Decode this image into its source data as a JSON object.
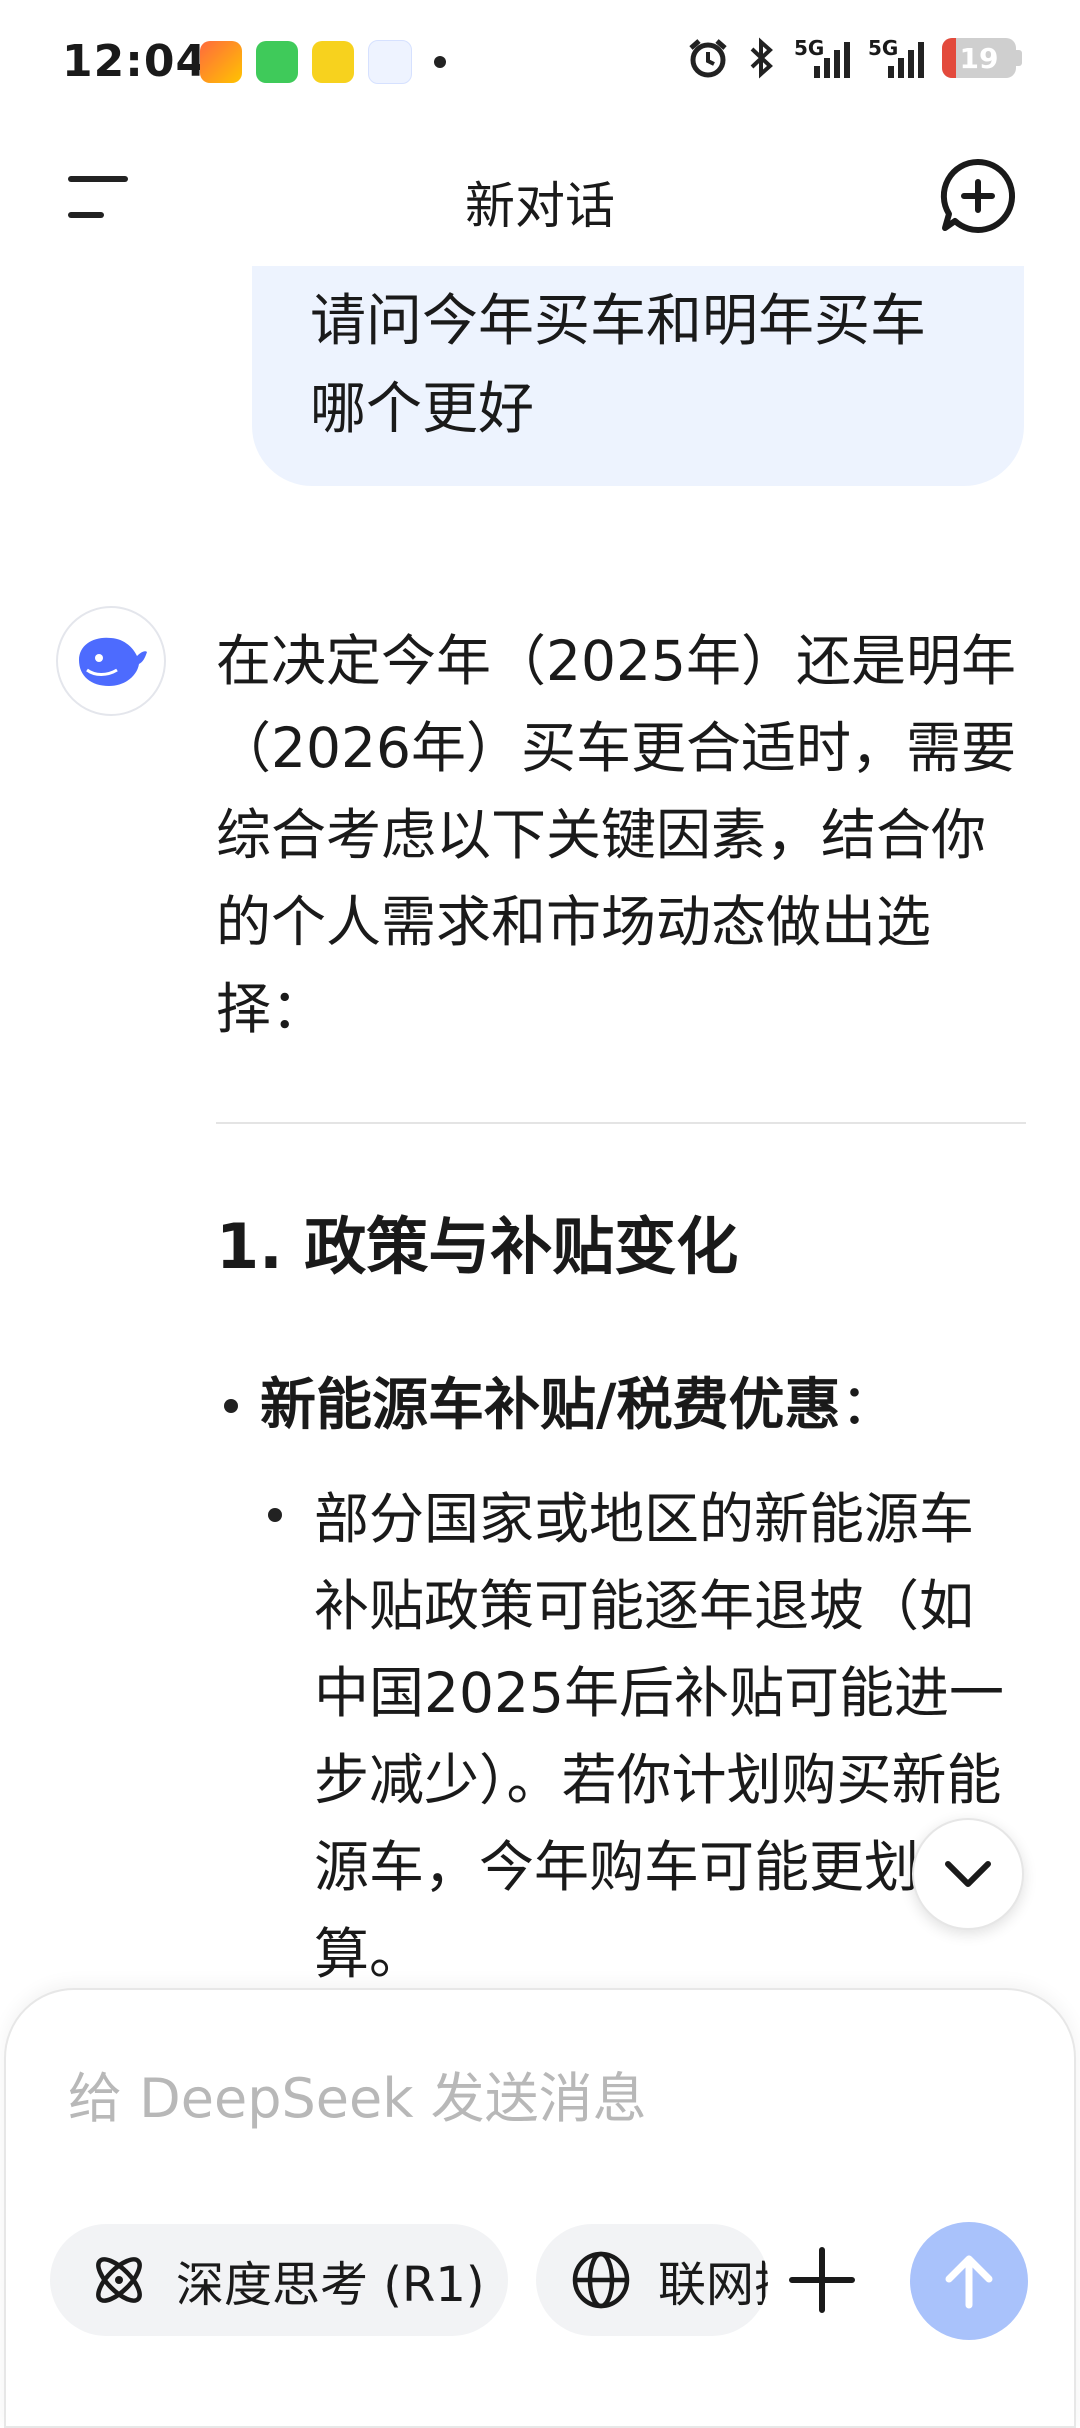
{
  "status_bar": {
    "time": "12:04",
    "signal_1": "5G",
    "signal_2": "5G",
    "battery": "19",
    "battery_level": 0.19,
    "icons": [
      "app-icon-1",
      "messages-icon",
      "notes-icon",
      "app-icon-4",
      "notification-dot",
      "alarm-icon",
      "bluetooth-icon"
    ]
  },
  "header": {
    "title": "新对话"
  },
  "conversation": {
    "user_message": "请问今年买车和明年买车哪个更好",
    "assistant": {
      "intro": "在决定今年（2025年）还是明年（2026年）买车更合适时，需要综合考虑以下关键因素，结合你的个人需求和市场动态做出选择：",
      "section_title": "1. 政策与补贴变化",
      "bullet_bold": "新能源车补贴/税费优惠",
      "bullet_suffix": "：",
      "sub_bullet": "部分国家或地区的新能源车补贴政策可能逐年退坡（如中国2025年后补贴可能进一步减少）。若你计划购买新能源车，今年购车可能更划算。"
    }
  },
  "composer": {
    "placeholder": "给 DeepSeek 发送消息",
    "deep_think_label": "深度思考 (R1)",
    "web_search_label": "联网搜索"
  },
  "colors": {
    "user_bubble_bg": "#edf3fe",
    "send_button": "#a9c2fb",
    "brand_blue": "#4d6bfe",
    "battery_low": "#e34a3c"
  }
}
